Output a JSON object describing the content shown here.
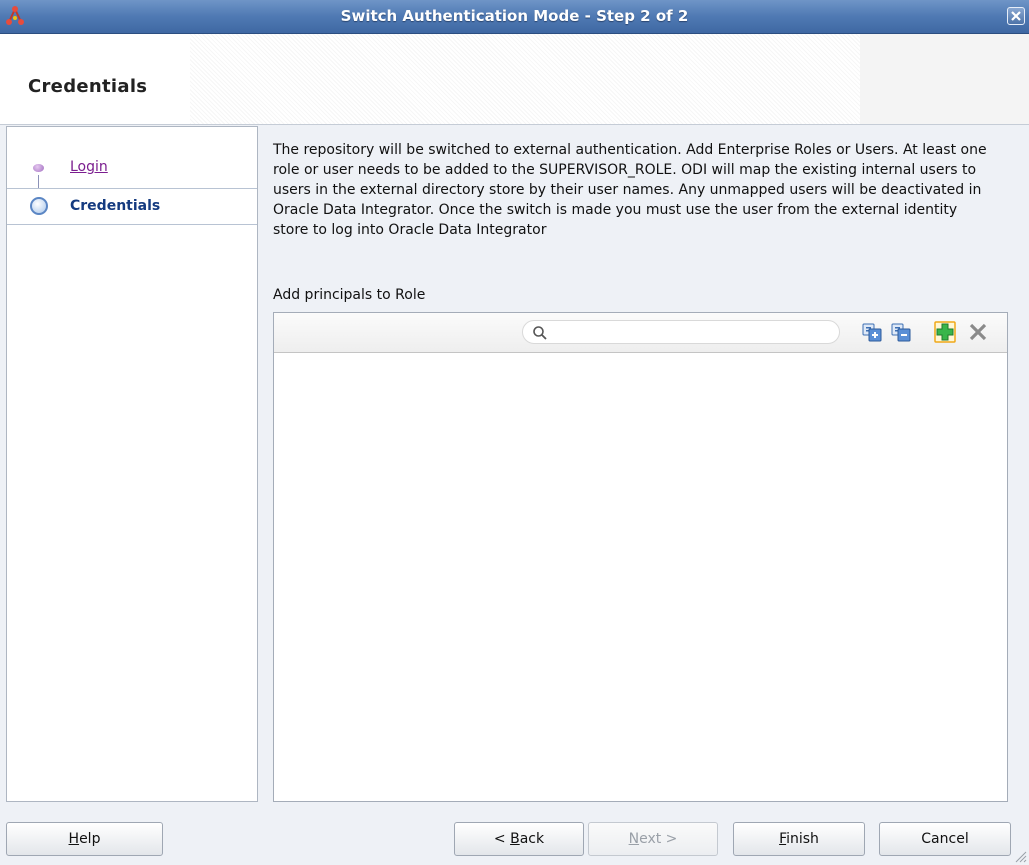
{
  "window": {
    "title": "Switch Authentication Mode - Step 2 of 2"
  },
  "header": {
    "title": "Credentials"
  },
  "nav": {
    "items": [
      {
        "label": "Login",
        "state": "visited"
      },
      {
        "label": "Credentials",
        "state": "current"
      }
    ]
  },
  "main": {
    "description": "The repository will be switched to external authentication. Add Enterprise Roles or Users. At least one role or user needs to be added to the SUPERVISOR_ROLE. ODI will map the existing internal users to users in the external directory store by their user names. Any unmapped users will be deactivated in Oracle Data Integrator. Once the switch is made you must use the user from the external identity store to log into Oracle Data Integrator",
    "principals_label": "Add principals to Role",
    "search": {
      "value": "",
      "placeholder": ""
    },
    "toolbar_icons": [
      "add-role-icon",
      "remove-role-icon",
      "add-icon",
      "delete-icon"
    ],
    "principals": []
  },
  "buttons": {
    "help": {
      "pre": "",
      "mnemonic": "H",
      "post": "elp",
      "enabled": true
    },
    "back": {
      "pre": "< ",
      "mnemonic": "B",
      "post": "ack",
      "enabled": true
    },
    "next": {
      "pre": "",
      "mnemonic": "N",
      "post": "ext >",
      "enabled": false
    },
    "finish": {
      "pre": "",
      "mnemonic": "F",
      "post": "inish",
      "enabled": true
    },
    "cancel": {
      "pre": "Cancel",
      "mnemonic": "",
      "post": "",
      "enabled": true
    }
  },
  "colors": {
    "titlebar": "#4f79b3",
    "visited_link": "#7b1d8f",
    "current_step": "#153b80",
    "add_icon": "#39b54a"
  }
}
